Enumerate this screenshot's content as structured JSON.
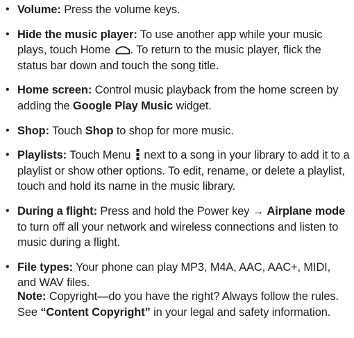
{
  "bullet_glyph": "•",
  "items": [
    {
      "label": "Volume:",
      "text": " Press the volume keys."
    },
    {
      "label": "Hide the music player:",
      "text_before_icon": " To use another app while your music plays, touch Home ",
      "icon": "home-icon",
      "text_after_icon": ". To return to the music player, flick the status bar down and touch the song title."
    },
    {
      "label": "Home screen:",
      "text_before_bold": " Control music playback from the home screen by adding the ",
      "bold": "Google Play Music",
      "text_after_bold": " widget."
    },
    {
      "label": "Shop:",
      "text_before_bold": " Touch ",
      "bold": "Shop",
      "text_after_bold": " to shop for more music."
    },
    {
      "label": "Playlists:",
      "text_before_icon": " Touch Menu ",
      "icon": "menu-icon",
      "text_after_icon": " next to a song in your library to add it to a playlist or show other options. To edit, rename, or delete a playlist, touch and hold its name in the music library."
    },
    {
      "label": "During a flight:",
      "text_before_bold": " Press and hold the Power key → ",
      "bold": "Airplane mode",
      "text_after_bold": " to turn off all your network and wireless connections and listen to music during a flight."
    },
    {
      "label": "File types:",
      "text": " Your phone can play MP3, M4A, AAC, AAC+, MIDI, and WAV files."
    }
  ],
  "note": {
    "label": "Note:",
    "text_before_bold": " Copyright—do you have the right? Always follow the rules. See ",
    "bold": "“Content Copyright”",
    "text_after_bold": " in your legal and safety information."
  }
}
